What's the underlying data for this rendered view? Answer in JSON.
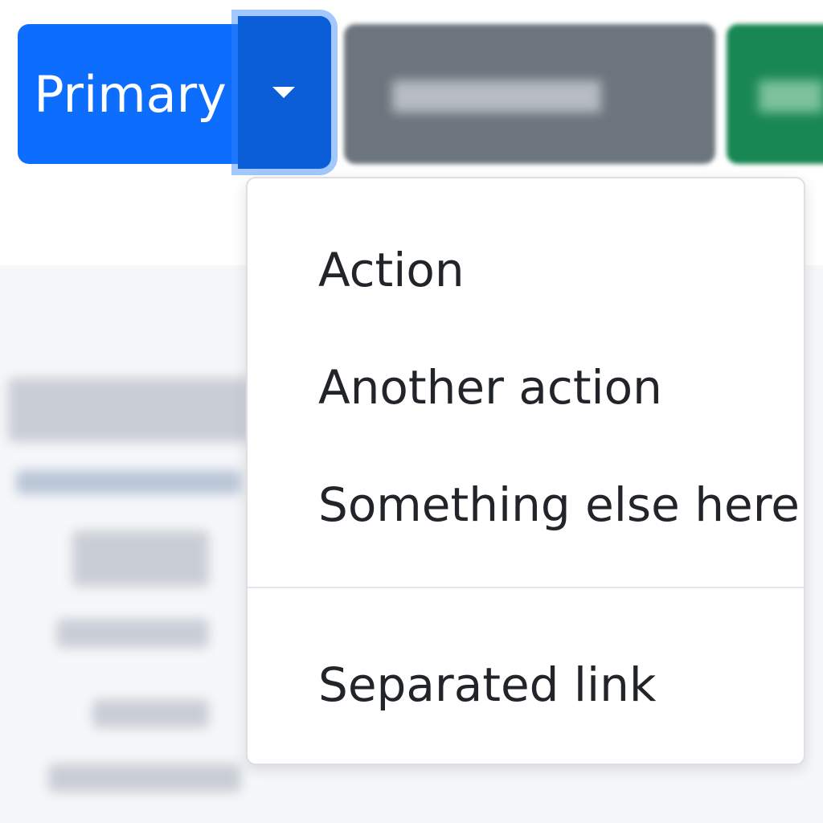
{
  "button_group": {
    "primary_label": "Primary",
    "toggle_icon": "caret-down-icon",
    "colors": {
      "primary": "#0d6efd",
      "primary_toggle": "#0b5ed7",
      "secondary": "#6c757d",
      "success": "#198754"
    }
  },
  "dropdown": {
    "items": [
      {
        "label": "Action"
      },
      {
        "label": "Another action"
      },
      {
        "label": "Something else here"
      }
    ],
    "separated_item": {
      "label": "Separated link"
    }
  }
}
